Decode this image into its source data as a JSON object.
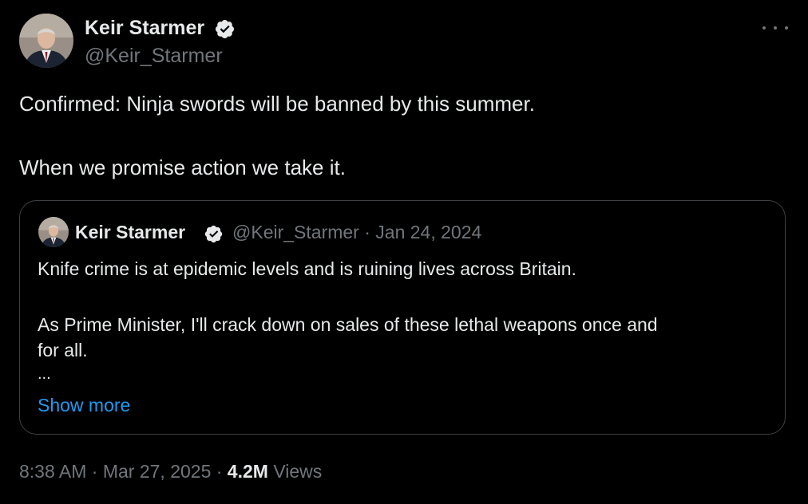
{
  "author": {
    "name": "Keir Starmer",
    "handle": "@Keir_Starmer"
  },
  "tweet": {
    "line1": "Confirmed: Ninja swords will be banned by this summer.",
    "line2": "When we promise action we take it."
  },
  "quoted": {
    "name": "Keir Starmer",
    "meta": "@Keir_Starmer · Jan 24, 2024",
    "line1": "Knife crime is at epidemic levels and is ruining lives across Britain.",
    "line2": "As Prime Minister, I'll crack down on sales of these lethal weapons once and",
    "line3": "for all.",
    "ellipsis": "...",
    "show_more": "Show more"
  },
  "footer": {
    "time": "8:38 AM · Mar 27, 2025 · ",
    "views_count": "4.2M",
    "views_label": " Views"
  },
  "icons": {
    "verified": "verified-badge-icon",
    "more": "more-options-icon"
  },
  "colors": {
    "background": "#000000",
    "text": "#e7e9ea",
    "muted": "#71767b",
    "link": "#1d9bf0",
    "border": "#3e4144"
  }
}
